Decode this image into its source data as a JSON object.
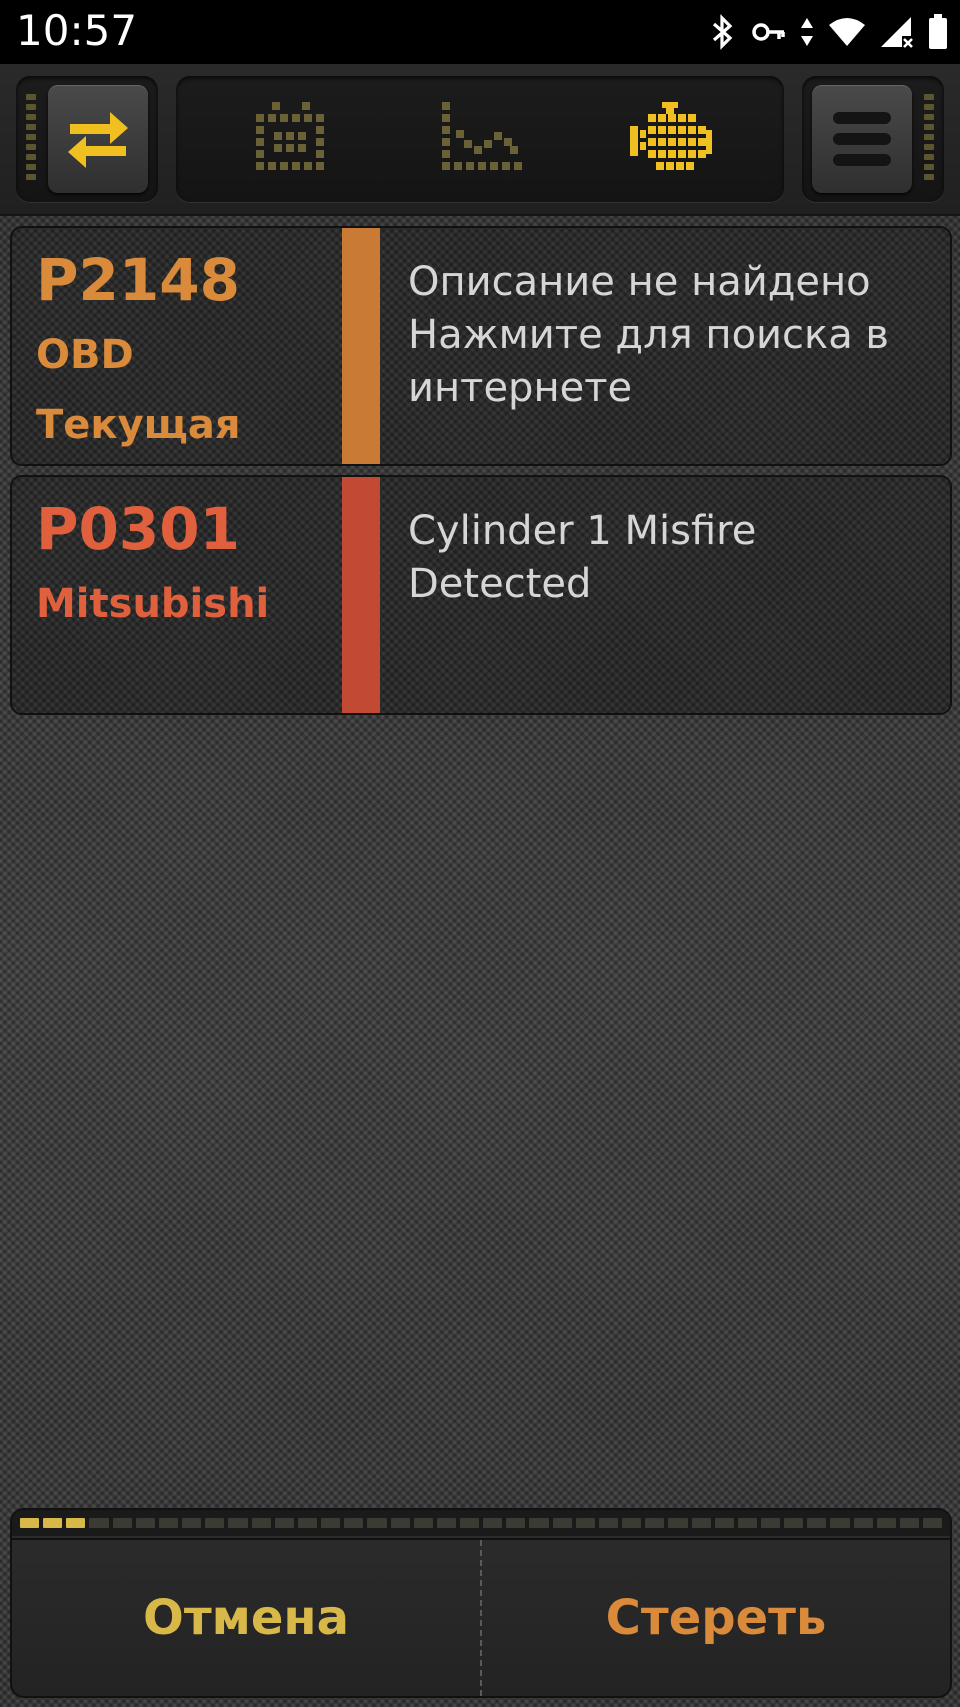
{
  "status_bar": {
    "time": "10:57",
    "icons": [
      "bluetooth-icon",
      "vpn-key-icon",
      "data-arrows-icon",
      "wifi-icon",
      "cell-signal-icon",
      "battery-icon"
    ]
  },
  "toolbar": {
    "left_button_icon": "swap-arrows-icon",
    "tabs": [
      {
        "icon": "dashboard-grid-icon",
        "active": false
      },
      {
        "icon": "graph-icon",
        "active": false
      },
      {
        "icon": "engine-icon",
        "active": true
      }
    ],
    "menu_icon": "menu-icon"
  },
  "codes": [
    {
      "code": "P2148",
      "line2": "OBD",
      "line3": "Текущая",
      "description": "Описание не найдено\nНажмите для поиска в интернете",
      "color": "#d98a3a",
      "bar_color": "#c97a35"
    },
    {
      "code": "P0301",
      "line2": "Mitsubishi",
      "line3": "",
      "description": "Cylinder 1 Misfire Detected",
      "color": "#e0603e",
      "bar_color": "#c24a34"
    }
  ],
  "progress": {
    "filled": 3,
    "total": 40
  },
  "buttons": {
    "cancel": "Отмена",
    "clear": "Стереть",
    "cancel_color": "#d9b84a",
    "clear_color": "#d98a3a"
  },
  "colors": {
    "accent_yellow": "#f0c020",
    "inactive_icon": "#6a6236"
  }
}
